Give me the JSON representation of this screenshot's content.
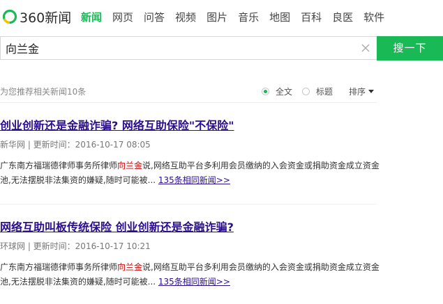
{
  "logo": {
    "text": "360新闻"
  },
  "nav": {
    "items": [
      "新闻",
      "网页",
      "问答",
      "视频",
      "图片",
      "音乐",
      "地图",
      "百科",
      "良医",
      "软件"
    ],
    "active": 0
  },
  "search": {
    "value": "向兰金",
    "button_label": "搜一下"
  },
  "toolbar": {
    "recommend_text": "为您推荐相关新闻10条",
    "options": [
      {
        "label": "全文",
        "checked": true
      },
      {
        "label": "标题",
        "checked": false
      }
    ],
    "sort_label": "排序"
  },
  "results": [
    {
      "title": "创业创新还是金融诈骗? 网络互助保险\"不保险\"",
      "meta": "新华网 | 更新时间：2016-10-17 08:05",
      "snippet_before": "广东南方福瑞德律师事务所律师",
      "snippet_highlight": "向兰金",
      "snippet_after": "说,网络互助平台多利用会员缴纳的入会资金或捐助资金成立资金池,无法摆脱非法集资的嫌疑,随时可能被...",
      "more_link": "135条相同新闻>>"
    },
    {
      "title": "网络互助叫板传统保险 创业创新还是金融诈骗?",
      "meta": "环球网 | 更新时间：2016-10-17 10:21",
      "snippet_before": "广东南方福瑞德律师事务所律师",
      "snippet_highlight": "向兰金",
      "snippet_after": "说,网络互助平台多利用会员缴纳的入会资金或捐助资金成立资金池,无法摆脱非法集资的嫌疑,随时可能被...",
      "more_link": "135条相同新闻>>"
    }
  ],
  "colors": {
    "brand_green": "#19b955",
    "link": "#2b0e8f",
    "highlight": "#cc0000"
  },
  "icons": {
    "logo": "360-logo-icon",
    "clear": "close-icon",
    "sort": "caret-down-icon"
  }
}
